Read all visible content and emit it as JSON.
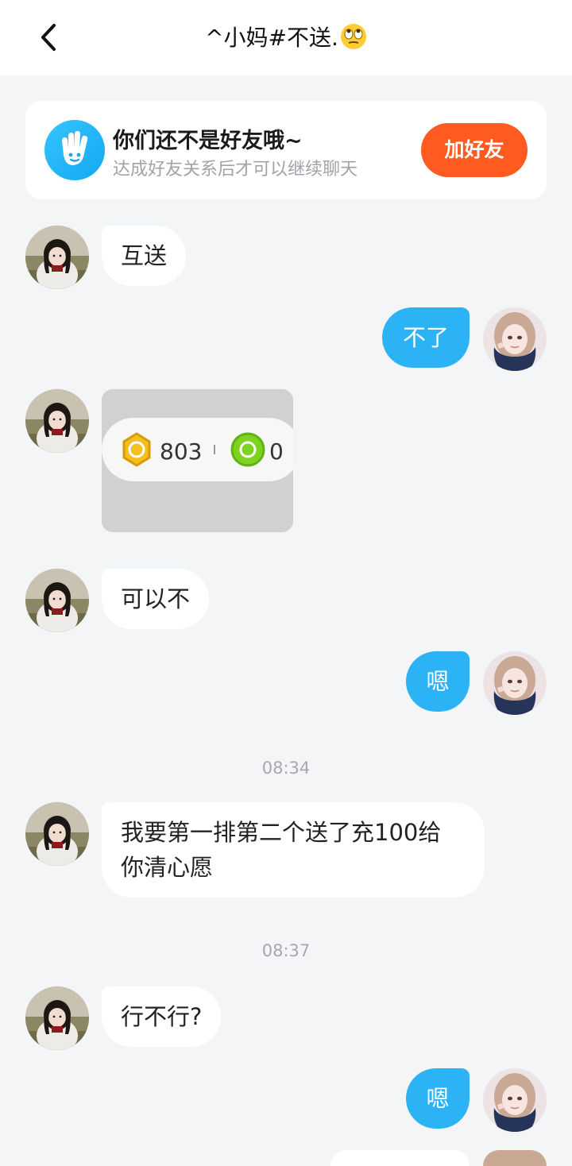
{
  "header": {
    "title": "^小妈#不送."
  },
  "friend_prompt": {
    "title": "你们还不是好友哦~",
    "subtitle": "达成好友关系后才可以继续聊天",
    "button_label": "加好友"
  },
  "messages": [
    {
      "side": "left",
      "text": "互送"
    },
    {
      "side": "right",
      "text": "不了"
    },
    {
      "side": "left",
      "type": "image",
      "image": {
        "gold_value": "803",
        "green_value": "0"
      }
    },
    {
      "side": "left",
      "text": "可以不"
    },
    {
      "side": "right",
      "text": "嗯"
    },
    {
      "type": "time",
      "text": "08:34"
    },
    {
      "side": "left",
      "text_line1": "我要第一排第二个送了充100给",
      "text_line2": "你清心愿"
    },
    {
      "type": "time",
      "text": "08:37"
    },
    {
      "side": "left",
      "text": "行不行?"
    },
    {
      "side": "right",
      "text": "嗯"
    }
  ],
  "colors": {
    "accent_blue": "#2bb3f5",
    "add_friend_orange": "#ff5a1f",
    "background": "#f4f5f7"
  },
  "icons": {
    "back": "chevron-left-icon",
    "emoji": "eye-roll-emoji-icon",
    "friend_card": "waving-hand-icon"
  }
}
